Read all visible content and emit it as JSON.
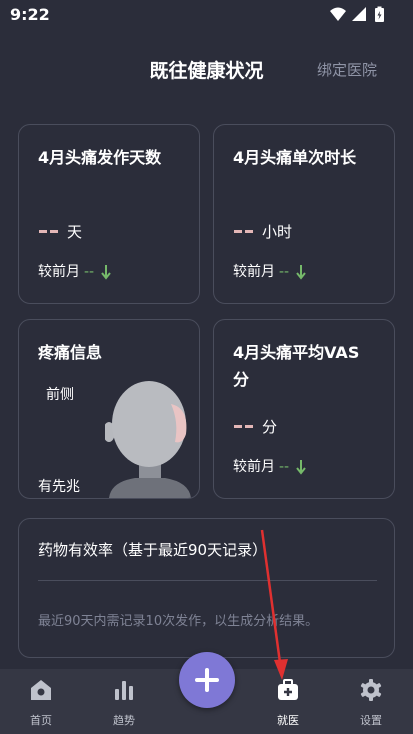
{
  "status": {
    "time": "9:22"
  },
  "header": {
    "title": "既往健康状况",
    "bind_hospital": "绑定医院"
  },
  "cards": {
    "days": {
      "title": "4月头痛发作天数",
      "unit": "天",
      "compare_label": "较前月",
      "compare_value": "--"
    },
    "duration": {
      "title": "4月头痛单次时长",
      "unit": "小时",
      "compare_label": "较前月",
      "compare_value": "--"
    },
    "pain_info": {
      "title": "疼痛信息",
      "location": "前侧",
      "aura": "有先兆"
    },
    "vas": {
      "title_line1": "4月头痛平均VAS",
      "title_line2": "分",
      "unit": "分",
      "compare_label": "较前月",
      "compare_value": "--"
    }
  },
  "medication": {
    "title": "药物有效率（基于最近90天记录）",
    "hint": "最近90天内需记录10次发作，以生成分析结果。"
  },
  "tabbar": {
    "items": [
      {
        "label": "首页",
        "icon": "home-icon"
      },
      {
        "label": "趋势",
        "icon": "bar-chart-icon"
      },
      {
        "label": "就医",
        "icon": "medical-kit-icon"
      },
      {
        "label": "设置",
        "icon": "gear-icon"
      }
    ],
    "fab_icon": "plus-icon"
  },
  "colors": {
    "background": "#2b2d3a",
    "accent": "#7f78d6",
    "trend_down": "#76b96a",
    "annotation": "#e03030"
  }
}
